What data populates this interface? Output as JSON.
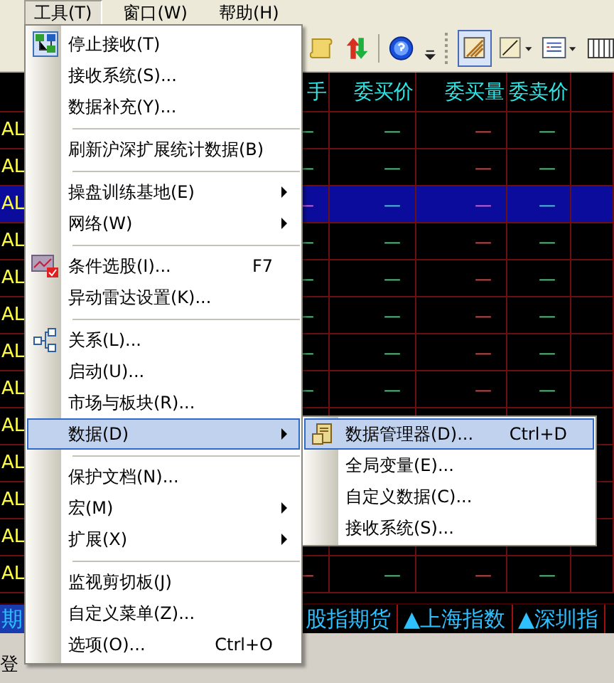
{
  "menubar": [
    {
      "label": "工具(T)",
      "selected": true
    },
    {
      "label": "窗口(W)",
      "selected": false
    },
    {
      "label": "帮助(H)",
      "selected": false
    }
  ],
  "table": {
    "columns": [
      {},
      {},
      {
        "label": "手"
      },
      {
        "label": "委买价"
      },
      {
        "label": "委买量"
      },
      {
        "label": "委卖价"
      },
      {}
    ],
    "rows": [
      {
        "code": "AL",
        "selected": false,
        "cells": [
          {
            "text": "—",
            "color": "#40e080"
          },
          {
            "text": "—",
            "color": "#40e080"
          },
          {
            "text": "—",
            "color": "#ff4040"
          },
          {
            "text": "—",
            "color": "#40e080"
          }
        ]
      },
      {
        "code": "AL",
        "selected": false,
        "cells": [
          {
            "text": "—",
            "color": "#40e080"
          },
          {
            "text": "—",
            "color": "#40e080"
          },
          {
            "text": "—",
            "color": "#ff4040"
          },
          {
            "text": "—",
            "color": "#40e080"
          }
        ]
      },
      {
        "code": "AL",
        "selected": true,
        "cells": [
          {
            "text": "—",
            "color": "#ff60c0"
          },
          {
            "text": "—",
            "color": "#40e0c0"
          },
          {
            "text": "—",
            "color": "#ff60c0"
          },
          {
            "text": "—",
            "color": "#40e0c0"
          }
        ]
      },
      {
        "code": "AL",
        "selected": false,
        "cells": [
          {
            "text": "—",
            "color": "#40e080"
          },
          {
            "text": "—",
            "color": "#40e080"
          },
          {
            "text": "—",
            "color": "#ff4040"
          },
          {
            "text": "—",
            "color": "#40e080"
          }
        ]
      },
      {
        "code": "AL",
        "selected": false,
        "cells": [
          {
            "text": "—",
            "color": "#40e080"
          },
          {
            "text": "—",
            "color": "#40e080"
          },
          {
            "text": "—",
            "color": "#ff4040"
          },
          {
            "text": "—",
            "color": "#40e080"
          }
        ]
      },
      {
        "code": "AL",
        "selected": false,
        "cells": [
          {
            "text": "—",
            "color": "#40e080"
          },
          {
            "text": "—",
            "color": "#40e080"
          },
          {
            "text": "—",
            "color": "#ff4040"
          },
          {
            "text": "—",
            "color": "#40e080"
          }
        ]
      },
      {
        "code": "AL",
        "selected": false,
        "cells": [
          {
            "text": "—",
            "color": "#40e080"
          },
          {
            "text": "—",
            "color": "#40e080"
          },
          {
            "text": "—",
            "color": "#ff4040"
          },
          {
            "text": "—",
            "color": "#40e080"
          }
        ]
      },
      {
        "code": "AL",
        "selected": false,
        "cells": [
          {
            "text": "—",
            "color": "#40e080"
          },
          {
            "text": "—",
            "color": "#40e080"
          },
          {
            "text": "—",
            "color": "#ff4040"
          },
          {
            "text": "—",
            "color": "#40e080"
          }
        ]
      },
      {
        "code": "AL",
        "selected": false
      },
      {
        "code": "AL",
        "selected": false
      },
      {
        "code": "AL",
        "selected": false
      },
      {
        "code": "AL",
        "selected": false
      },
      {
        "code": "AL",
        "selected": false,
        "cells": [
          {
            "text": "—",
            "color": "#ff4040"
          },
          {
            "text": "—",
            "color": "#40e080"
          },
          {
            "text": "—",
            "color": "#ff4040"
          },
          {
            "text": "—",
            "color": "#40e080"
          }
        ]
      }
    ]
  },
  "bottom_tabs": [
    {
      "label": "期",
      "selected": true
    },
    {
      "label": "股指期货",
      "selected": false
    },
    {
      "label": "▲上海指数",
      "selected": false
    },
    {
      "label": "▲深圳指",
      "selected": false
    }
  ],
  "status_bar": {
    "text": "登"
  },
  "menu": {
    "items": [
      {
        "kind": "item",
        "label": "停止接收(T)"
      },
      {
        "kind": "item",
        "label": "接收系统(S)..."
      },
      {
        "kind": "item",
        "label": "数据补充(Y)..."
      },
      {
        "kind": "separator"
      },
      {
        "kind": "item",
        "label": "刷新沪深扩展统计数据(B)"
      },
      {
        "kind": "separator"
      },
      {
        "kind": "submenu",
        "label": "操盘训练基地(E)"
      },
      {
        "kind": "submenu",
        "label": "网络(W)"
      },
      {
        "kind": "separator"
      },
      {
        "kind": "item",
        "label": "条件选股(I)...",
        "shortcut": "F7"
      },
      {
        "kind": "item",
        "label": "异动雷达设置(K)..."
      },
      {
        "kind": "separator"
      },
      {
        "kind": "item",
        "label": "关系(L)..."
      },
      {
        "kind": "item",
        "label": "启动(U)..."
      },
      {
        "kind": "item",
        "label": "市场与板块(R)..."
      },
      {
        "kind": "submenu",
        "label": "数据(D)",
        "selected": true
      },
      {
        "kind": "separator"
      },
      {
        "kind": "item",
        "label": "保护文档(N)..."
      },
      {
        "kind": "submenu",
        "label": "宏(M)"
      },
      {
        "kind": "submenu",
        "label": "扩展(X)"
      },
      {
        "kind": "separator"
      },
      {
        "kind": "item",
        "label": "监视剪切板(J)"
      },
      {
        "kind": "item",
        "label": "自定义菜单(Z)..."
      },
      {
        "kind": "item",
        "label": "选项(O)...",
        "shortcut": "Ctrl+O"
      }
    ]
  },
  "submenu": {
    "items": [
      {
        "label": "数据管理器(D)...",
        "shortcut": "Ctrl+D",
        "selected": true
      },
      {
        "label": "全局变量(E)...",
        "selected": false
      },
      {
        "label": "自定义数据(C)...",
        "selected": false
      },
      {
        "label": "接收系统(S)...",
        "selected": false
      }
    ]
  }
}
